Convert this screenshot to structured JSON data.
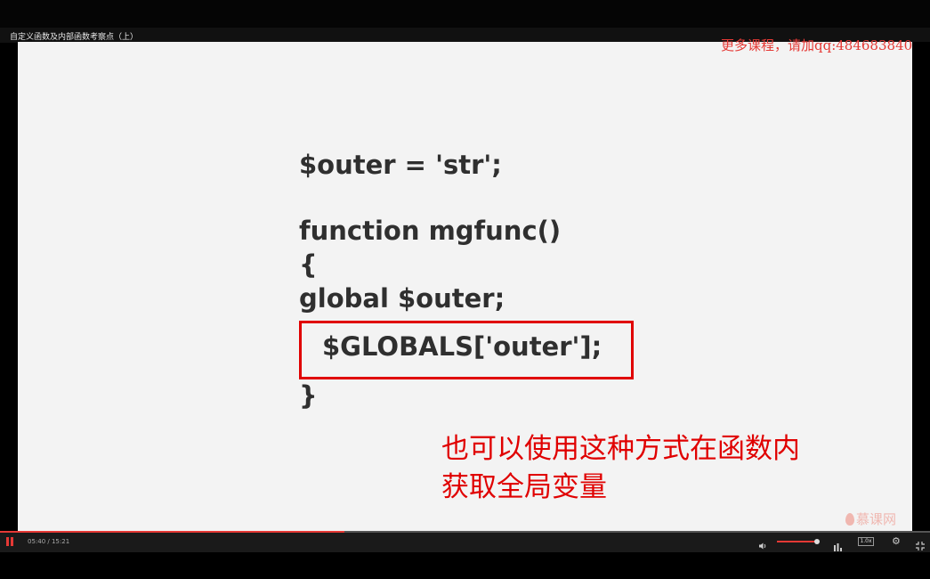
{
  "video": {
    "title": "自定义函数及内部函数考察点（上）",
    "watermark": "更多课程，请加qq:484683840",
    "progress_percent": 37
  },
  "slide": {
    "code_lines": [
      "$outer = 'str';",
      "function mgfunc()",
      "{",
      "global $outer;",
      "$GLOBALS['outer'];",
      "}"
    ],
    "note_lines": [
      "也可以使用这种方式在函数内",
      "获取全局变量"
    ],
    "logo_text": "慕课网"
  },
  "controls": {
    "time": "05:40 / 15:21",
    "speed": "1.0x",
    "volume_percent": 100
  },
  "colors": {
    "accent": "#e53935",
    "highlight": "#e00000",
    "slide_bg": "#f3f3f3",
    "code_text": "#2f2f2f"
  },
  "icons": [
    "pause-icon",
    "volume-icon",
    "quality-icon",
    "settings-icon",
    "fullscreen-icon",
    "imooc-flame-icon"
  ]
}
